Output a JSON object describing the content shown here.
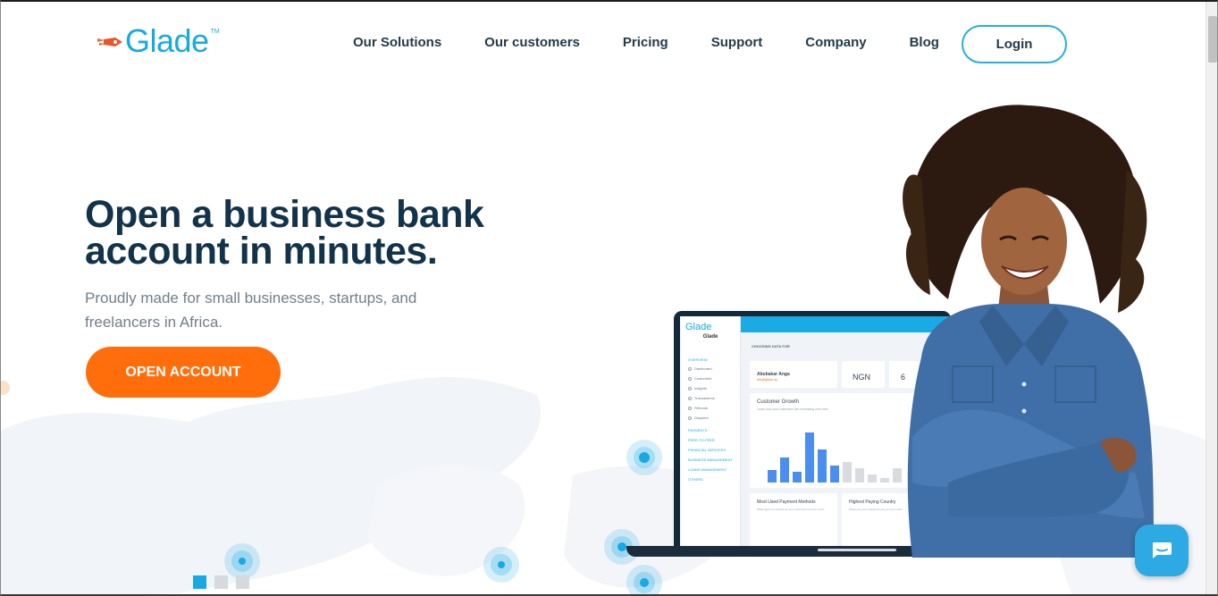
{
  "brand": {
    "name": "Glade",
    "tm": "TM"
  },
  "nav": {
    "items": [
      {
        "label": "Our Solutions"
      },
      {
        "label": "Our customers"
      },
      {
        "label": "Pricing"
      },
      {
        "label": "Support"
      },
      {
        "label": "Company"
      },
      {
        "label": "Blog"
      }
    ],
    "login_label": "Login"
  },
  "hero": {
    "title_line1": "Open a business bank",
    "title_line2": "account in minutes.",
    "subtitle": "Proudly made for small businesses, startups, and freelancers in Africa.",
    "cta_label": "OPEN ACCOUNT"
  },
  "slider": {
    "count": 3,
    "active_index": 0
  },
  "dashboard": {
    "logo": "Glade",
    "brand": "Glade",
    "section_label": "CHOOSING DATA FOR",
    "sidebar": {
      "overview": "OVERVIEW",
      "items": [
        "Dashboard",
        "Customers",
        "Insights",
        "Transactions",
        "Refunds",
        "Disputes"
      ],
      "groups": [
        "PAYMENTS",
        "PEER-TO-PEER",
        "FINANCIAL SERVICES",
        "BUSINESS MANAGEMENT",
        "LOANS MANAGEMENT",
        "OTHERS"
      ]
    },
    "user_name": "Abubakar Anga",
    "user_email": "abs@glade.ng",
    "currency": "NGN",
    "count": "6",
    "chart_title": "Customer Growth",
    "chart_sub": "Learn how your customers are increasing over time",
    "card_payment_title": "Most Used Payment Methods",
    "card_payment_sub": "What payment method do your customers use the most?",
    "card_country_title": "Highest Paying Country",
    "card_country_sub": "Where do your customers pay you the most?"
  },
  "colors": {
    "brand_blue": "#18a9e3",
    "cta_orange": "#ff6e0a",
    "heading_navy": "#12334a",
    "text_grey": "#6f7f8c"
  },
  "icons": {
    "logo_mark": "rocket-icon",
    "chat": "chat-bubble-icon"
  }
}
